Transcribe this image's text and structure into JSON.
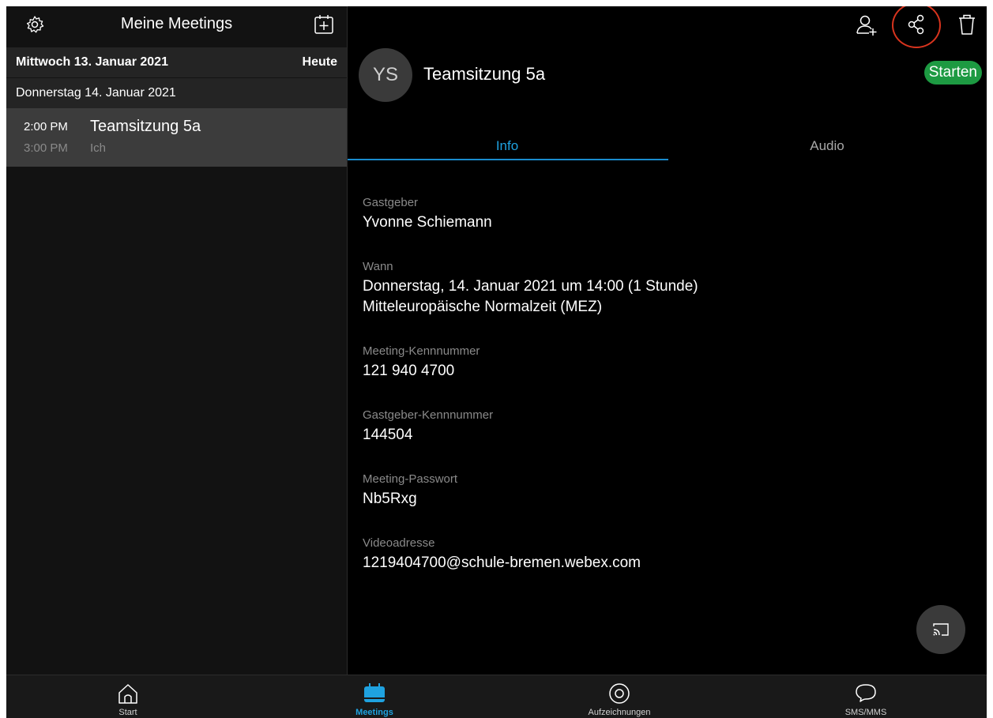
{
  "colors": {
    "accent_blue": "#1fa2e0",
    "start_green": "#1d9a42",
    "highlight_red": "#d8341e",
    "background": "#000000"
  },
  "sidebar": {
    "title": "Meine Meetings",
    "settings_icon": "gear-icon",
    "new_meeting_icon": "calendar-add-icon",
    "days": [
      {
        "date": "Mittwoch 13. Januar 2021",
        "badge": "Heute"
      },
      {
        "date": "Donnerstag 14. Januar 2021"
      }
    ],
    "meetings": [
      {
        "start": "2:00 PM",
        "end": "3:00 PM",
        "title": "Teamsitzung 5a",
        "host": "Ich"
      }
    ]
  },
  "toolbar": {
    "icons": [
      "add-participant-icon",
      "share-icon",
      "trash-icon"
    ]
  },
  "detail": {
    "avatar_initials": "YS",
    "title": "Teamsitzung 5a",
    "start_button": "Starten",
    "tabs": [
      {
        "label": "Info",
        "active": true
      },
      {
        "label": "Audio",
        "active": false
      }
    ],
    "fields": {
      "host_label": "Gastgeber",
      "host_value": "Yvonne Schiemann",
      "when_label": "Wann",
      "when_line1": "Donnerstag, 14. Januar 2021 um 14:00 (1 Stunde)",
      "when_line2": "Mitteleuropäische Normalzeit (MEZ)",
      "meeting_number_label": "Meeting-Kennnummer",
      "meeting_number_value": "121 940 4700",
      "host_key_label": "Gastgeber-Kennnummer",
      "host_key_value": "144504",
      "password_label": "Meeting-Passwort",
      "password_value": "Nb5Rxg",
      "video_address_label": "Videoadresse",
      "video_address_value": "1219404700@schule-bremen.webex.com"
    },
    "cast_icon": "cast-icon"
  },
  "bottom_nav": {
    "items": [
      {
        "label": "Start",
        "icon": "home-icon",
        "active": false
      },
      {
        "label": "Meetings",
        "icon": "calendar-icon",
        "active": true
      },
      {
        "label": "Aufzeichnungen",
        "icon": "recording-icon",
        "active": false
      },
      {
        "label": "SMS/MMS",
        "icon": "chat-bubble-icon",
        "active": false
      }
    ]
  }
}
